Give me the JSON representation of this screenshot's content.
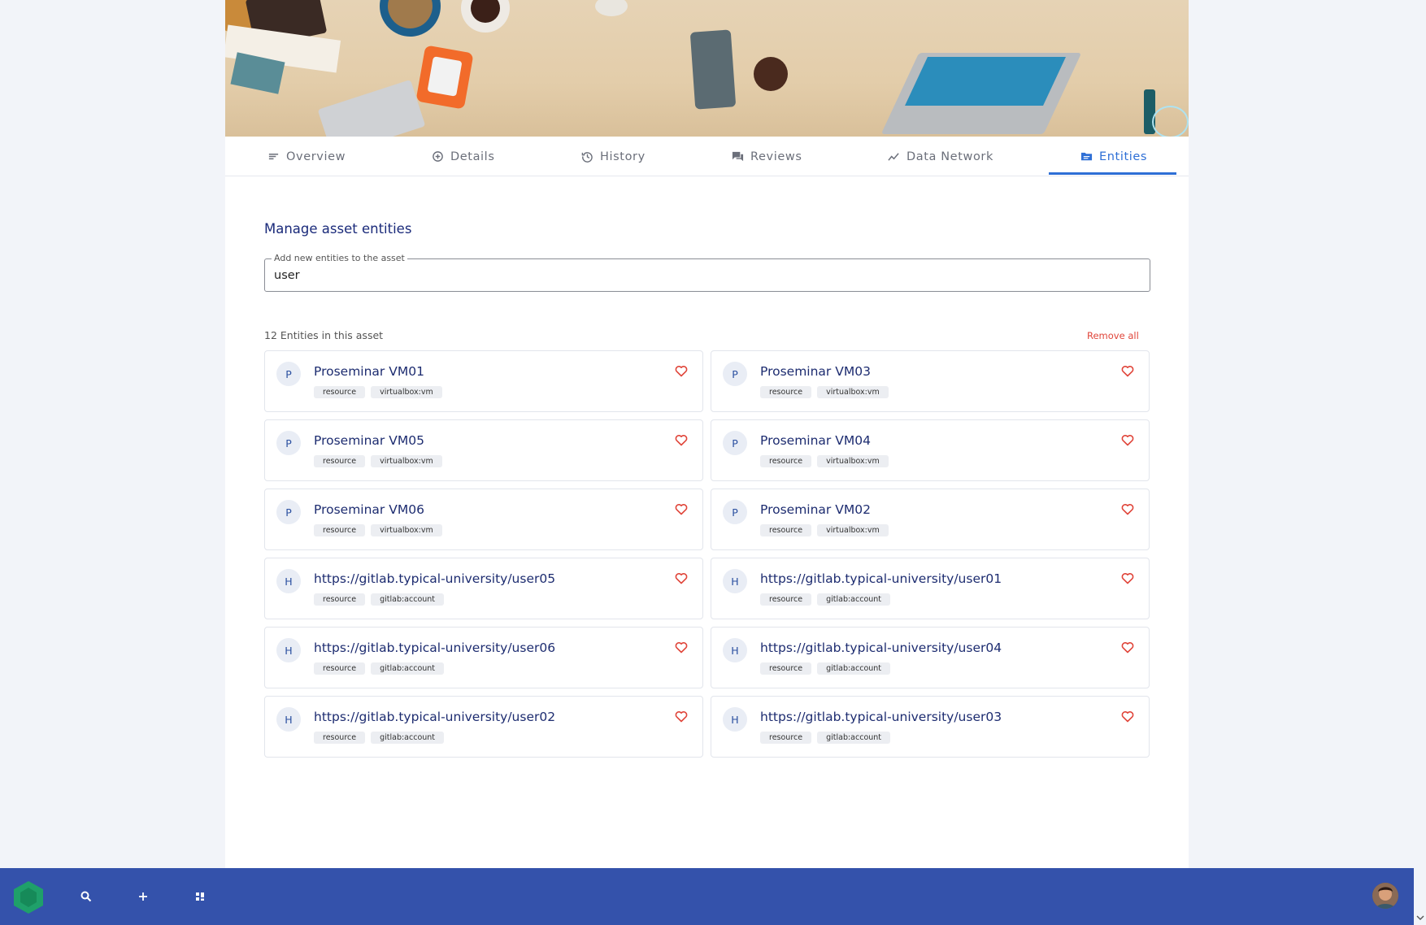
{
  "tabs": [
    {
      "label": "Overview",
      "icon": "lines-icon",
      "active": false
    },
    {
      "label": "Details",
      "icon": "plus-circle-icon",
      "active": false
    },
    {
      "label": "History",
      "icon": "history-icon",
      "active": false
    },
    {
      "label": "Reviews",
      "icon": "chat-icon",
      "active": false
    },
    {
      "label": "Data Network",
      "icon": "trend-icon",
      "active": false
    },
    {
      "label": "Entities",
      "icon": "folder-icon",
      "active": true
    }
  ],
  "main": {
    "section_title": "Manage asset entities",
    "field_label": "Add new entities to the asset",
    "field_value": "user",
    "count_text": "12 Entities in this asset",
    "remove_all": "Remove all"
  },
  "entities": [
    {
      "avatar": "P",
      "title": "Proseminar VM01",
      "tags": [
        "resource",
        "virtualbox:vm"
      ]
    },
    {
      "avatar": "P",
      "title": "Proseminar VM03",
      "tags": [
        "resource",
        "virtualbox:vm"
      ]
    },
    {
      "avatar": "P",
      "title": "Proseminar VM05",
      "tags": [
        "resource",
        "virtualbox:vm"
      ]
    },
    {
      "avatar": "P",
      "title": "Proseminar VM04",
      "tags": [
        "resource",
        "virtualbox:vm"
      ]
    },
    {
      "avatar": "P",
      "title": "Proseminar VM06",
      "tags": [
        "resource",
        "virtualbox:vm"
      ]
    },
    {
      "avatar": "P",
      "title": "Proseminar VM02",
      "tags": [
        "resource",
        "virtualbox:vm"
      ]
    },
    {
      "avatar": "H",
      "title": "https://gitlab.typical-university/user05",
      "tags": [
        "resource",
        "gitlab:account"
      ]
    },
    {
      "avatar": "H",
      "title": "https://gitlab.typical-university/user01",
      "tags": [
        "resource",
        "gitlab:account"
      ]
    },
    {
      "avatar": "H",
      "title": "https://gitlab.typical-university/user06",
      "tags": [
        "resource",
        "gitlab:account"
      ]
    },
    {
      "avatar": "H",
      "title": "https://gitlab.typical-university/user04",
      "tags": [
        "resource",
        "gitlab:account"
      ]
    },
    {
      "avatar": "H",
      "title": "https://gitlab.typical-university/user02",
      "tags": [
        "resource",
        "gitlab:account"
      ]
    },
    {
      "avatar": "H",
      "title": "https://gitlab.typical-university/user03",
      "tags": [
        "resource",
        "gitlab:account"
      ]
    }
  ],
  "bottombar": {
    "icons": [
      "search-icon",
      "plus-icon",
      "grid-icon"
    ]
  },
  "colors": {
    "accent": "#2e6fd6",
    "bottombar": "#3452ab",
    "heart": "#e0453a",
    "title": "#1d2c70"
  }
}
